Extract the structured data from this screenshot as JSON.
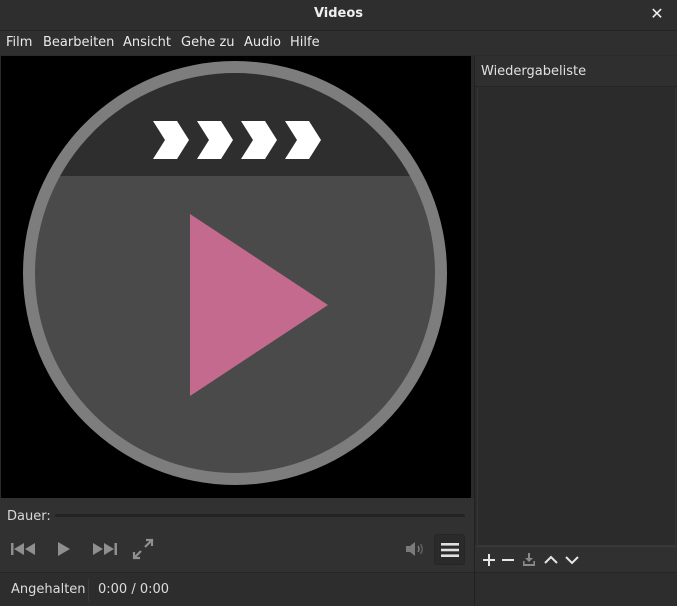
{
  "window": {
    "title": "Videos",
    "close_glyph": "✕"
  },
  "menu": {
    "items": [
      {
        "id": "film",
        "label": "Film"
      },
      {
        "id": "bearbeiten",
        "label": "Bearbeiten"
      },
      {
        "id": "ansicht",
        "label": "Ansicht"
      },
      {
        "id": "gehe-zu",
        "label": "Gehe zu"
      },
      {
        "id": "audio",
        "label": "Audio"
      },
      {
        "id": "hilfe",
        "label": "Hilfe"
      }
    ]
  },
  "player": {
    "logo_icon": "totem-film-reel-play-icon",
    "colors": {
      "ring": "#7d7d7d",
      "face": "#4a4a4a",
      "band": "#2e2e2e",
      "chevrons": "#ffffff",
      "play": "#c46a8e"
    }
  },
  "controls": {
    "duration_label": "Dauer:",
    "buttons": [
      {
        "id": "previous",
        "icon": "skip-previous-icon"
      },
      {
        "id": "play",
        "icon": "play-icon"
      },
      {
        "id": "next",
        "icon": "skip-next-icon"
      },
      {
        "id": "fullscreen",
        "icon": "fullscreen-icon"
      },
      {
        "id": "volume",
        "icon": "volume-icon"
      },
      {
        "id": "menu",
        "icon": "hamburger-menu-icon"
      }
    ]
  },
  "status": {
    "state": "Angehalten",
    "time": "0:00 / 0:00"
  },
  "sidebar": {
    "title": "Wiedergabeliste",
    "toolbar": [
      {
        "id": "add",
        "icon": "plus-icon"
      },
      {
        "id": "remove",
        "icon": "minus-icon"
      },
      {
        "id": "save",
        "icon": "save-download-icon"
      },
      {
        "id": "up",
        "icon": "chevron-up-icon"
      },
      {
        "id": "down",
        "icon": "chevron-down-icon"
      }
    ]
  }
}
